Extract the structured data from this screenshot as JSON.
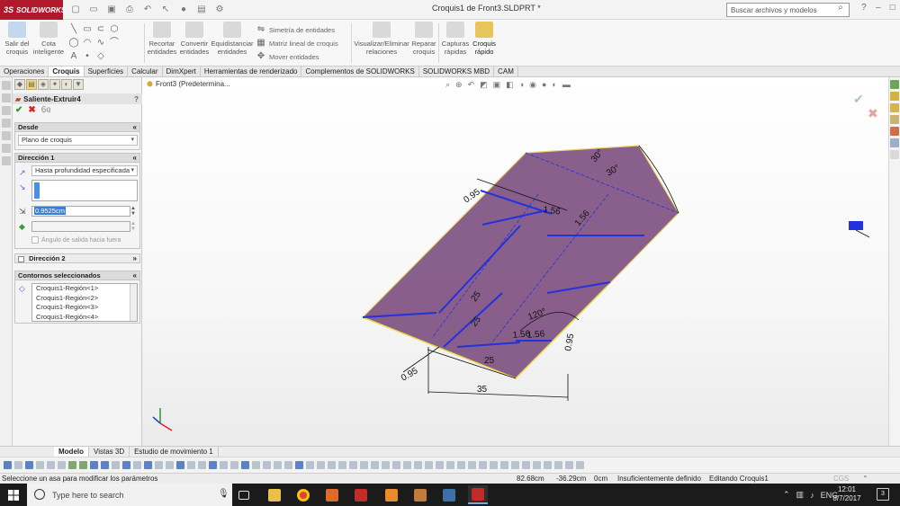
{
  "app": {
    "logo_text": "SOLIDWORKS",
    "logo_mark": "3S",
    "doc_title": "Croquis1 de Front3.SLDPRT *"
  },
  "search": {
    "placeholder": "Buscar archivos y modelos"
  },
  "commands": {
    "big": [
      {
        "label": "Salir del\ncroquis",
        "icon": "exit-sketch-icon"
      },
      {
        "label": "Cota\ninteligente",
        "icon": "smart-dimension-icon"
      },
      {
        "label": "Recortar\nentidades",
        "icon": "trim-icon"
      },
      {
        "label": "Convertir\nentidades",
        "icon": "convert-icon"
      },
      {
        "label": "Equidistanciar\nentidades",
        "icon": "offset-icon"
      },
      {
        "label": "Visualizar/Eliminar\nrelaciones",
        "icon": "relations-icon"
      },
      {
        "label": "Reparar\ncroquis",
        "icon": "repair-icon"
      },
      {
        "label": "Capturas\nrápidas",
        "icon": "snaps-icon"
      },
      {
        "label": "Croquis\nrápido",
        "icon": "rapid-sketch-icon"
      }
    ],
    "small": [
      {
        "label": "Simetría de entidades"
      },
      {
        "label": "Matriz lineal de croquis"
      },
      {
        "label": "Mover entidades"
      }
    ]
  },
  "tabs": [
    "Operaciones",
    "Croquis",
    "Superficies",
    "Calcular",
    "DimXpert",
    "Herramientas de renderizado",
    "Complementos de SOLIDWORKS",
    "SOLIDWORKS MBD",
    "CAM"
  ],
  "property_manager": {
    "title": "Saliente-Extruir4",
    "from": {
      "header": "Desde",
      "value": "Plano de croquis"
    },
    "direction1": {
      "header": "Dirección 1",
      "end_condition": "Hasta profundidad especificada",
      "depth": "0.9525cm",
      "draft_label": "Ángulo de salida hacia fuera"
    },
    "direction2": {
      "header": "Dirección 2"
    },
    "contours": {
      "header": "Contornos seleccionados",
      "items": [
        "Croquis1-Región<1>",
        "Croquis1-Región<2>",
        "Croquis1-Región<3>",
        "Croquis1-Región<4>"
      ]
    }
  },
  "viewport": {
    "tree_label": "Front3  (Predetermina...",
    "fill_color": "#7a4a7c",
    "sketch_color": "#2233dd",
    "dimensions": [
      "0.95",
      "30°",
      "30°",
      "1.56",
      "1.56",
      "25",
      "25",
      "120°",
      "1.56",
      "1.56",
      "0.95",
      "0.95",
      "25",
      "35"
    ]
  },
  "bottom_tabs": [
    "Modelo",
    "Vistas 3D",
    "Estudio de movimiento 1"
  ],
  "status": {
    "message": "Seleccione un asa para modificar los parámetros",
    "x": "82.68cm",
    "y": "-36.29cm",
    "z": "0cm",
    "state": "Insuficientemente definido",
    "mode": "Editando Croquis1",
    "units": "CGS"
  },
  "taskbar": {
    "search_placeholder": "Type here to search",
    "lang": "ENG",
    "time": "12:01",
    "date": "8/7/2017",
    "notifications": "3"
  }
}
